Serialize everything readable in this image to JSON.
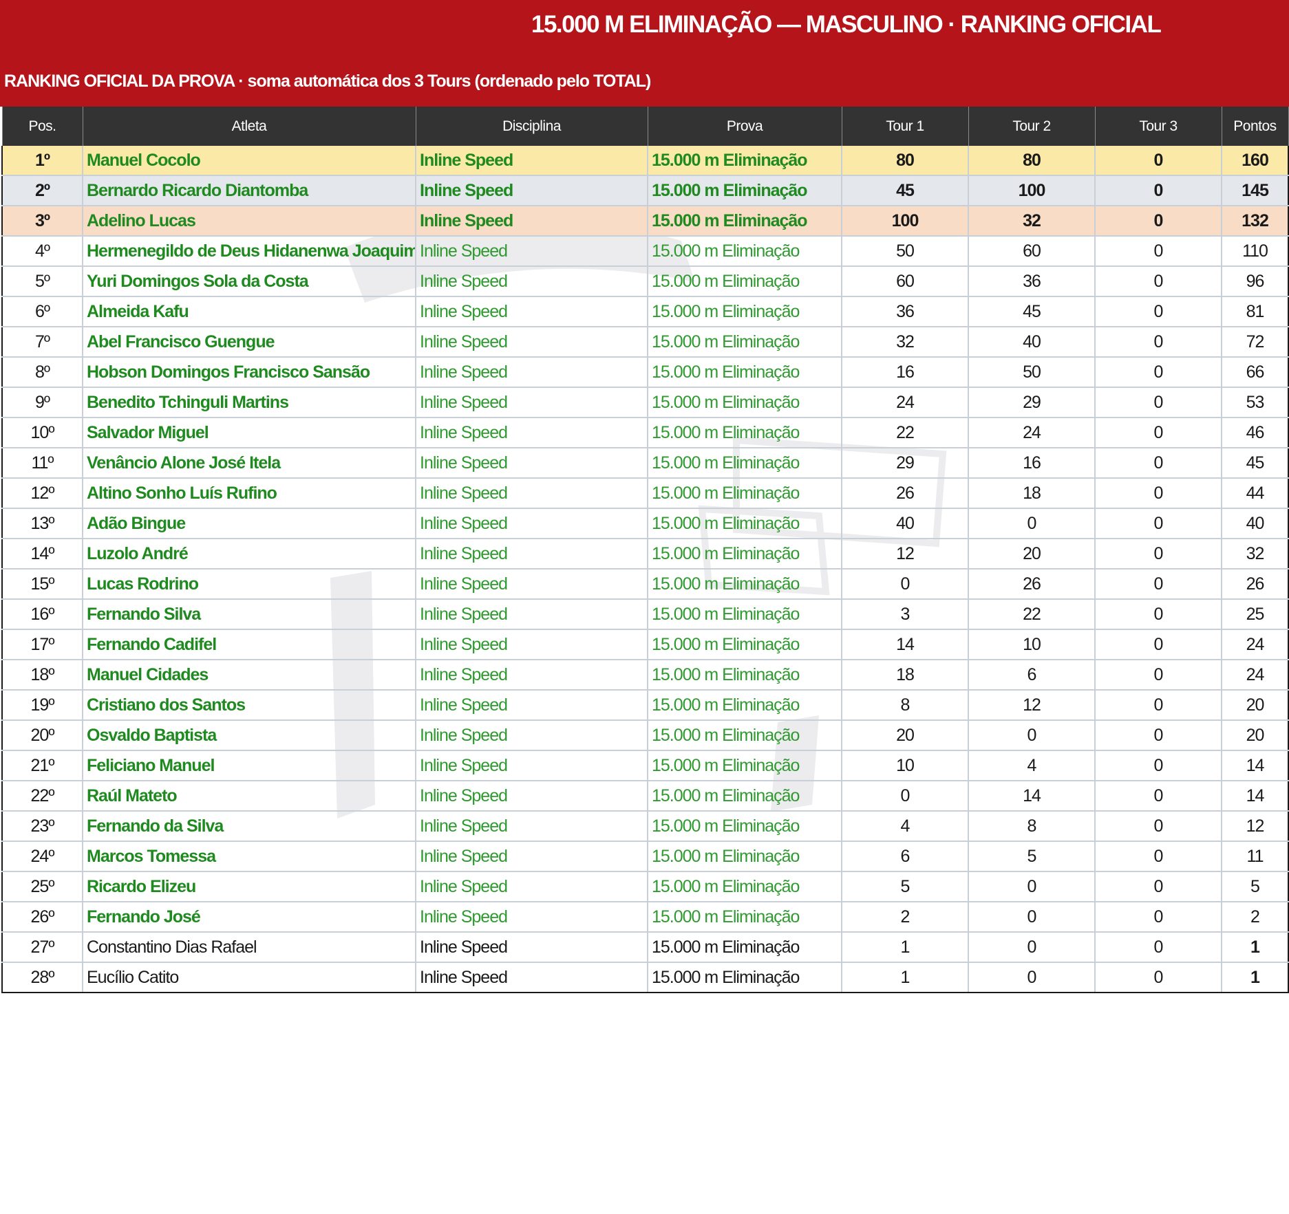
{
  "header": {
    "title": "15.000 M ELIMINAÇÃO — MASCULINO · RANKING OFICIAL",
    "subtitle": "RANKING OFICIAL DA PROVA · soma automática dos 3 Tours (ordenado pelo TOTAL)"
  },
  "columns": [
    "Pos.",
    "Atleta",
    "Disciplina",
    "Prova",
    "Tour 1",
    "Tour 2",
    "Tour 3",
    "Pontos"
  ],
  "rows": [
    {
      "pos": "1º",
      "athlete": "Manuel Cocolo",
      "discipline": "Inline Speed",
      "event": "15.000 m Eliminação",
      "t1": "80",
      "t2": "80",
      "t3": "0",
      "pts": "160"
    },
    {
      "pos": "2º",
      "athlete": "Bernardo Ricardo Diantomba",
      "discipline": "Inline Speed",
      "event": "15.000 m Eliminação",
      "t1": "45",
      "t2": "100",
      "t3": "0",
      "pts": "145"
    },
    {
      "pos": "3º",
      "athlete": "Adelino Lucas",
      "discipline": "Inline Speed",
      "event": "15.000 m Eliminação",
      "t1": "100",
      "t2": "32",
      "t3": "0",
      "pts": "132"
    },
    {
      "pos": "4º",
      "athlete": "Hermenegildo de Deus Hidanenwa Joaquim",
      "discipline": "Inline Speed",
      "event": "15.000 m Eliminação",
      "t1": "50",
      "t2": "60",
      "t3": "0",
      "pts": "110"
    },
    {
      "pos": "5º",
      "athlete": "Yuri Domingos Sola da Costa",
      "discipline": "Inline Speed",
      "event": "15.000 m Eliminação",
      "t1": "60",
      "t2": "36",
      "t3": "0",
      "pts": "96"
    },
    {
      "pos": "6º",
      "athlete": "Almeida Kafu",
      "discipline": "Inline Speed",
      "event": "15.000 m Eliminação",
      "t1": "36",
      "t2": "45",
      "t3": "0",
      "pts": "81"
    },
    {
      "pos": "7º",
      "athlete": "Abel Francisco Guengue",
      "discipline": "Inline Speed",
      "event": "15.000 m Eliminação",
      "t1": "32",
      "t2": "40",
      "t3": "0",
      "pts": "72"
    },
    {
      "pos": "8º",
      "athlete": "Hobson Domingos Francisco Sansão",
      "discipline": "Inline Speed",
      "event": "15.000 m Eliminação",
      "t1": "16",
      "t2": "50",
      "t3": "0",
      "pts": "66"
    },
    {
      "pos": "9º",
      "athlete": "Benedito Tchinguli Martins",
      "discipline": "Inline Speed",
      "event": "15.000 m Eliminação",
      "t1": "24",
      "t2": "29",
      "t3": "0",
      "pts": "53"
    },
    {
      "pos": "10º",
      "athlete": "Salvador Miguel",
      "discipline": "Inline Speed",
      "event": "15.000 m Eliminação",
      "t1": "22",
      "t2": "24",
      "t3": "0",
      "pts": "46"
    },
    {
      "pos": "11º",
      "athlete": "Venâncio Alone José Itela",
      "discipline": "Inline Speed",
      "event": "15.000 m Eliminação",
      "t1": "29",
      "t2": "16",
      "t3": "0",
      "pts": "45"
    },
    {
      "pos": "12º",
      "athlete": "Altino Sonho Luís Rufino",
      "discipline": "Inline Speed",
      "event": "15.000 m Eliminação",
      "t1": "26",
      "t2": "18",
      "t3": "0",
      "pts": "44"
    },
    {
      "pos": "13º",
      "athlete": "Adão Bingue",
      "discipline": "Inline Speed",
      "event": "15.000 m Eliminação",
      "t1": "40",
      "t2": "0",
      "t3": "0",
      "pts": "40"
    },
    {
      "pos": "14º",
      "athlete": "Luzolo André",
      "discipline": "Inline Speed",
      "event": "15.000 m Eliminação",
      "t1": "12",
      "t2": "20",
      "t3": "0",
      "pts": "32"
    },
    {
      "pos": "15º",
      "athlete": "Lucas Rodrino",
      "discipline": "Inline Speed",
      "event": "15.000 m Eliminação",
      "t1": "0",
      "t2": "26",
      "t3": "0",
      "pts": "26"
    },
    {
      "pos": "16º",
      "athlete": "Fernando Silva",
      "discipline": "Inline Speed",
      "event": "15.000 m Eliminação",
      "t1": "3",
      "t2": "22",
      "t3": "0",
      "pts": "25"
    },
    {
      "pos": "17º",
      "athlete": "Fernando Cadifel",
      "discipline": "Inline Speed",
      "event": "15.000 m Eliminação",
      "t1": "14",
      "t2": "10",
      "t3": "0",
      "pts": "24"
    },
    {
      "pos": "18º",
      "athlete": "Manuel Cidades",
      "discipline": "Inline Speed",
      "event": "15.000 m Eliminação",
      "t1": "18",
      "t2": "6",
      "t3": "0",
      "pts": "24"
    },
    {
      "pos": "19º",
      "athlete": "Cristiano dos Santos",
      "discipline": "Inline Speed",
      "event": "15.000 m Eliminação",
      "t1": "8",
      "t2": "12",
      "t3": "0",
      "pts": "20"
    },
    {
      "pos": "20º",
      "athlete": "Osvaldo Baptista",
      "discipline": "Inline Speed",
      "event": "15.000 m Eliminação",
      "t1": "20",
      "t2": "0",
      "t3": "0",
      "pts": "20"
    },
    {
      "pos": "21º",
      "athlete": "Feliciano Manuel",
      "discipline": "Inline Speed",
      "event": "15.000 m Eliminação",
      "t1": "10",
      "t2": "4",
      "t3": "0",
      "pts": "14"
    },
    {
      "pos": "22º",
      "athlete": "Raúl Mateto",
      "discipline": "Inline Speed",
      "event": "15.000 m Eliminação",
      "t1": "0",
      "t2": "14",
      "t3": "0",
      "pts": "14"
    },
    {
      "pos": "23º",
      "athlete": "Fernando da Silva",
      "discipline": "Inline Speed",
      "event": "15.000 m Eliminação",
      "t1": "4",
      "t2": "8",
      "t3": "0",
      "pts": "12"
    },
    {
      "pos": "24º",
      "athlete": "Marcos Tomessa",
      "discipline": "Inline Speed",
      "event": "15.000 m Eliminação",
      "t1": "6",
      "t2": "5",
      "t3": "0",
      "pts": "11"
    },
    {
      "pos": "25º",
      "athlete": "Ricardo Elizeu",
      "discipline": "Inline Speed",
      "event": "15.000 m Eliminação",
      "t1": "5",
      "t2": "0",
      "t3": "0",
      "pts": "5"
    },
    {
      "pos": "26º",
      "athlete": "Fernando José",
      "discipline": "Inline Speed",
      "event": "15.000 m Eliminação",
      "t1": "2",
      "t2": "0",
      "t3": "0",
      "pts": "2"
    },
    {
      "pos": "27º",
      "athlete": "Constantino Dias Rafael",
      "discipline": "Inline Speed",
      "event": "15.000 m Eliminação",
      "t1": "1",
      "t2": "0",
      "t3": "0",
      "pts": "1"
    },
    {
      "pos": "28º",
      "athlete": "Eucílio Catito",
      "discipline": "Inline Speed",
      "event": "15.000 m Eliminação",
      "t1": "1",
      "t2": "0",
      "t3": "0",
      "pts": "1"
    }
  ],
  "colors": {
    "banner": "#b5141a",
    "header_row": "#333333",
    "green_text": "#1f8a1f",
    "gold_row": "#fbe9a8",
    "silver_row": "#e4e8ec",
    "bronze_row": "#f8dcc6"
  }
}
